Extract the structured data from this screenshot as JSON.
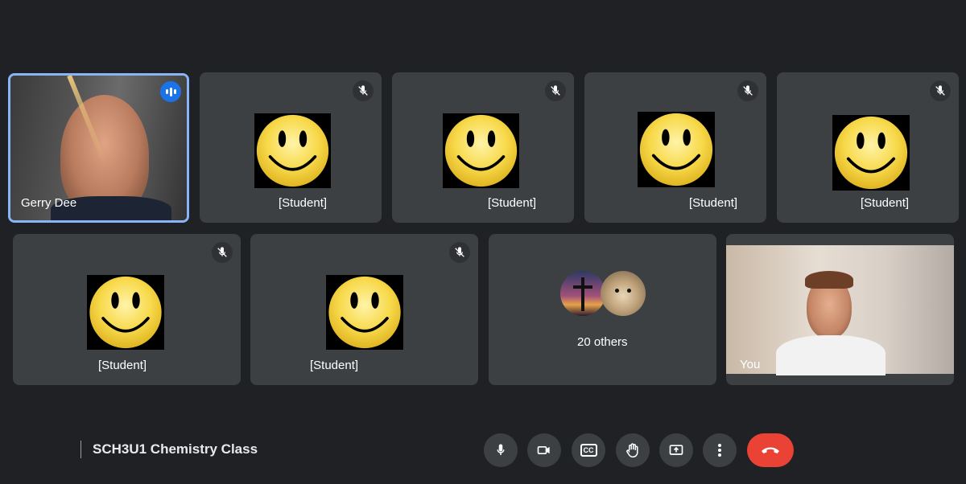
{
  "participants": {
    "teacher": {
      "name": "Gerry Dee"
    },
    "students": [
      {
        "name": "[Student]"
      },
      {
        "name": "[Student]"
      },
      {
        "name": "[Student]"
      },
      {
        "name": "[Student]"
      },
      {
        "name": "[Student]"
      },
      {
        "name": "[Student]"
      }
    ],
    "others": {
      "label": "20 others"
    },
    "self": {
      "name": "You"
    }
  },
  "meeting": {
    "title": "SCH3U1 Chemistry Class"
  },
  "controls": {
    "microphone": "mic-icon",
    "camera": "camera-icon",
    "captions": "CC",
    "raise_hand": "hand-icon",
    "present": "present-icon",
    "more": "more-vert-icon",
    "leave": "end-call-icon"
  },
  "colors": {
    "background": "#202124",
    "tile": "#3c4043",
    "active_border": "#8ab4f8",
    "end_call": "#ea4335"
  }
}
